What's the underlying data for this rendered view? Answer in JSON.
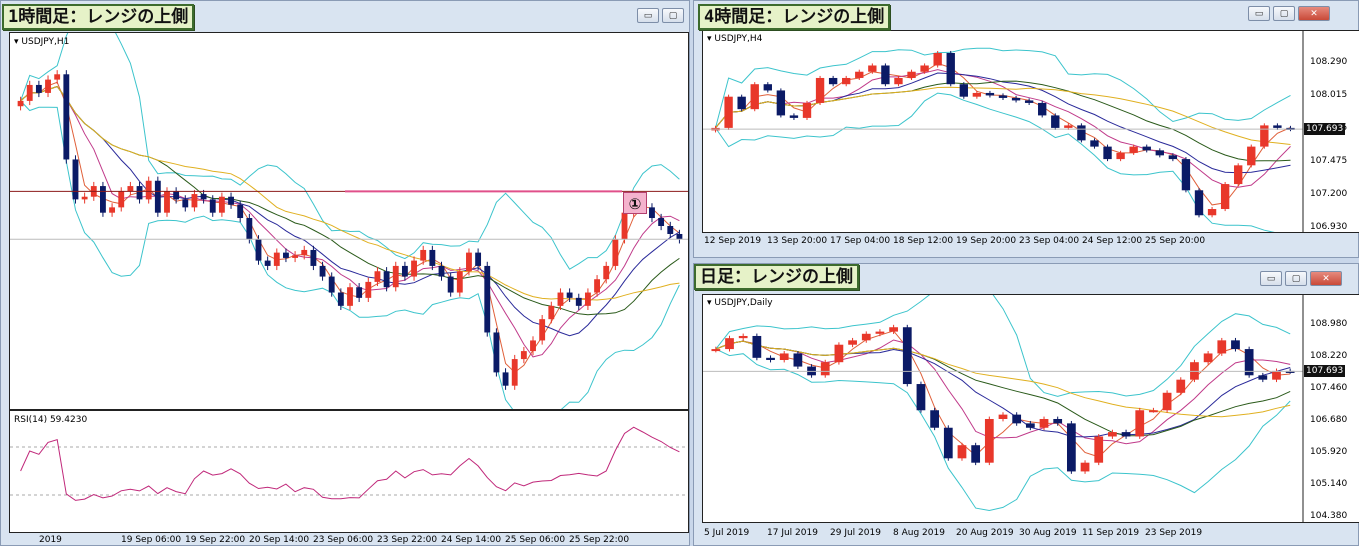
{
  "windows": {
    "h1": {
      "title": "1時間足：レンジの上側",
      "symbol": "USDJPY,H1",
      "rsi_label": "RSI(14) 59.4230",
      "marker": "①",
      "x_labels": [
        "2019",
        "19 Sep 06:00",
        "19 Sep 22:00",
        "20 Sep 14:00",
        "23 Sep 06:00",
        "23 Sep 22:00",
        "24 Sep 14:00",
        "25 Sep 06:00",
        "25 Sep 22:00"
      ]
    },
    "h4": {
      "title": "4時間足：レンジの上側",
      "symbol": "USDJPY,H4",
      "price_tag": "107.693",
      "y_labels": [
        "108.290",
        "108.015",
        "107.745",
        "107.475",
        "107.200",
        "106.930"
      ],
      "x_labels": [
        "12 Sep 2019",
        "13 Sep 20:00",
        "17 Sep 04:00",
        "18 Sep 12:00",
        "19 Sep 20:00",
        "23 Sep 04:00",
        "24 Sep 12:00",
        "25 Sep 20:00"
      ]
    },
    "daily": {
      "title": "日足：レンジの上側",
      "symbol": "USDJPY,Daily",
      "price_tag": "107.693",
      "y_labels": [
        "108.980",
        "108.220",
        "107.460",
        "106.680",
        "105.920",
        "105.140",
        "104.380"
      ],
      "x_labels": [
        "5 Jul 2019",
        "17 Jul 2019",
        "29 Jul 2019",
        "8 Aug 2019",
        "20 Aug 2019",
        "30 Aug 2019",
        "11 Sep 2019",
        "23 Sep 2019"
      ]
    }
  },
  "window_buttons": {
    "minimize": "▭",
    "maximize": "▢",
    "close": "✕"
  },
  "colors": {
    "bull": "#e8372a",
    "bear": "#0b1a66",
    "bollinger": "#3cc4cc",
    "resistance": "#e0508a",
    "h_line": "#8b1a1a",
    "rsi": "#c0287a",
    "ma": [
      "#e0603a",
      "#c03a8a",
      "#2a2a9a",
      "#2a5a1a",
      "#e0b020"
    ]
  },
  "chart_data": [
    {
      "type": "candlestick",
      "name_in_image": "USDJPY,H1",
      "y_range": [
        107.2,
        108.5
      ],
      "close_series": [
        108.32,
        108.38,
        108.35,
        108.4,
        108.42,
        108.1,
        107.95,
        107.96,
        108.0,
        107.9,
        107.92,
        107.98,
        108.0,
        107.95,
        108.02,
        107.9,
        107.98,
        107.95,
        107.92,
        107.97,
        107.95,
        107.9,
        107.96,
        107.93,
        107.88,
        107.8,
        107.72,
        107.7,
        107.75,
        107.73,
        107.74,
        107.76,
        107.7,
        107.66,
        107.6,
        107.55,
        107.62,
        107.58,
        107.64,
        107.68,
        107.62,
        107.7,
        107.66,
        107.72,
        107.76,
        107.7,
        107.66,
        107.6,
        107.68,
        107.75,
        107.7,
        107.45,
        107.3,
        107.25,
        107.35,
        107.38,
        107.42,
        107.5,
        107.55,
        107.6,
        107.58,
        107.55,
        107.6,
        107.65,
        107.7,
        107.8,
        107.9,
        107.95,
        107.92,
        107.88,
        107.85,
        107.82,
        107.8
      ]
    },
    {
      "type": "candlestick",
      "name_in_image": "USDJPY,H4",
      "y_range": [
        106.93,
        108.3
      ],
      "close_series": [
        107.7,
        107.95,
        107.85,
        108.05,
        108.0,
        107.8,
        107.78,
        107.9,
        108.1,
        108.05,
        108.1,
        108.15,
        108.2,
        108.05,
        108.1,
        108.15,
        108.2,
        108.3,
        108.05,
        107.95,
        107.98,
        107.96,
        107.94,
        107.92,
        107.9,
        107.8,
        107.7,
        107.72,
        107.6,
        107.55,
        107.45,
        107.5,
        107.55,
        107.52,
        107.48,
        107.45,
        107.2,
        107.0,
        107.05,
        107.25,
        107.4,
        107.55,
        107.72,
        107.7,
        107.69
      ]
    },
    {
      "type": "candlestick",
      "name_in_image": "USDJPY,Daily",
      "y_range": [
        104.38,
        108.98
      ],
      "close_series": [
        108.2,
        108.45,
        108.5,
        108.0,
        107.95,
        108.1,
        107.8,
        107.6,
        107.9,
        108.3,
        108.4,
        108.55,
        108.6,
        108.7,
        107.4,
        106.8,
        106.4,
        105.7,
        106.0,
        105.6,
        106.6,
        106.7,
        106.5,
        106.4,
        106.6,
        106.5,
        105.4,
        105.6,
        106.2,
        106.3,
        106.2,
        106.8,
        106.8,
        107.2,
        107.5,
        107.9,
        108.1,
        108.4,
        108.2,
        107.6,
        107.5,
        107.7,
        107.69
      ]
    }
  ]
}
